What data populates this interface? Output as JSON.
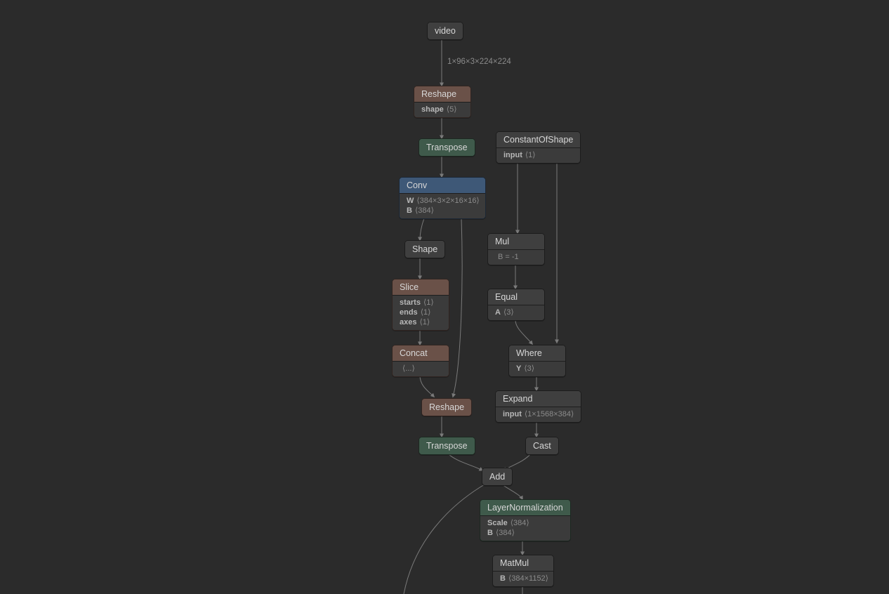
{
  "edge_labels": {
    "video_to_reshape": "1×96×3×224×224"
  },
  "nodes": {
    "video": {
      "title": "video"
    },
    "reshape1": {
      "title": "Reshape",
      "rows": [
        {
          "k": "shape",
          "v": "⟨5⟩"
        }
      ]
    },
    "transpose1": {
      "title": "Transpose"
    },
    "constantofshape": {
      "title": "ConstantOfShape",
      "rows": [
        {
          "k": "input",
          "v": "⟨1⟩"
        }
      ]
    },
    "conv": {
      "title": "Conv",
      "rows": [
        {
          "k": "W",
          "v": "⟨384×3×2×16×16⟩"
        },
        {
          "k": "B",
          "v": "⟨384⟩"
        }
      ]
    },
    "shape": {
      "title": "Shape"
    },
    "mul": {
      "title": "Mul",
      "rows": [
        {
          "k": "",
          "v": "B = -1"
        }
      ]
    },
    "slice": {
      "title": "Slice",
      "rows": [
        {
          "k": "starts",
          "v": "⟨1⟩"
        },
        {
          "k": "ends",
          "v": "⟨1⟩"
        },
        {
          "k": "axes",
          "v": "⟨1⟩"
        }
      ]
    },
    "equal": {
      "title": "Equal",
      "rows": [
        {
          "k": "A",
          "v": "⟨3⟩"
        }
      ]
    },
    "concat": {
      "title": "Concat",
      "rows": [
        {
          "k": "",
          "v": "⟨...⟩"
        }
      ]
    },
    "where": {
      "title": "Where",
      "rows": [
        {
          "k": "Y",
          "v": "⟨3⟩"
        }
      ]
    },
    "reshape2": {
      "title": "Reshape"
    },
    "expand": {
      "title": "Expand",
      "rows": [
        {
          "k": "input",
          "v": "⟨1×1568×384⟩"
        }
      ]
    },
    "transpose2": {
      "title": "Transpose"
    },
    "cast": {
      "title": "Cast"
    },
    "add": {
      "title": "Add"
    },
    "layernorm": {
      "title": "LayerNormalization",
      "rows": [
        {
          "k": "Scale",
          "v": "⟨384⟩"
        },
        {
          "k": "B",
          "v": "⟨384⟩"
        }
      ]
    },
    "matmul": {
      "title": "MatMul",
      "rows": [
        {
          "k": "B",
          "v": "⟨384×1152⟩"
        }
      ]
    }
  }
}
